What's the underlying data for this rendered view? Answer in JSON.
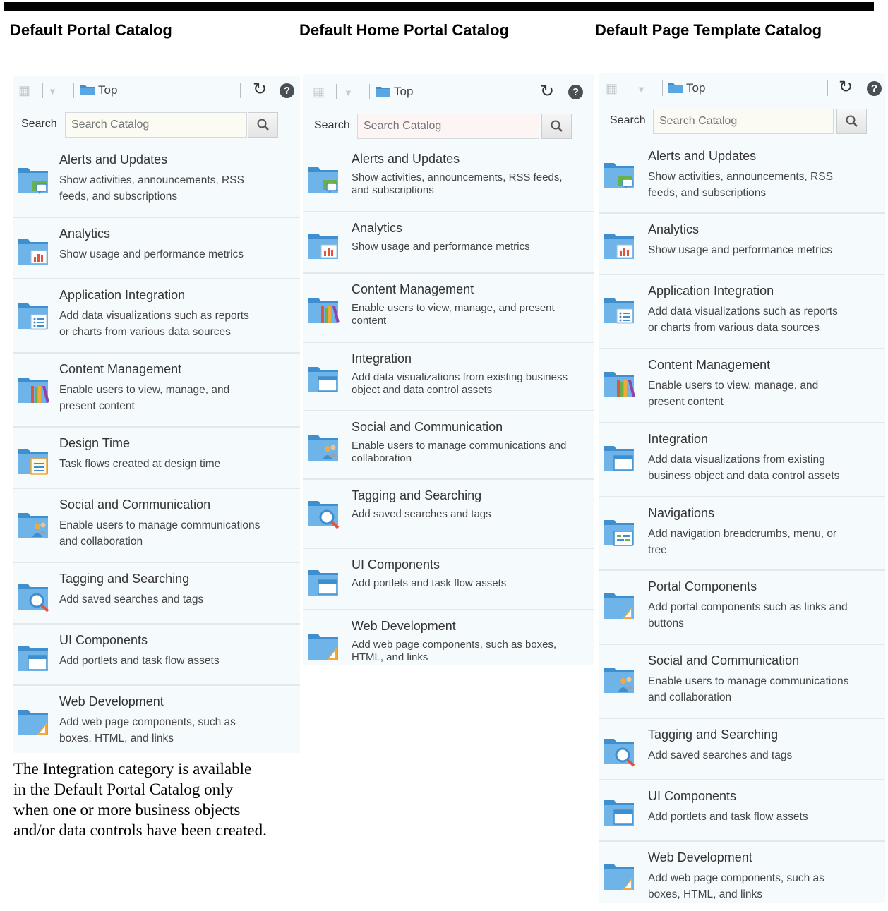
{
  "headers": [
    "Default Portal Catalog",
    "Default Home Portal Catalog",
    "Default Page Template Catalog"
  ],
  "toolbar": {
    "top_label": "Top",
    "search_label": "Search",
    "search_placeholder": "Search Catalog"
  },
  "catalogs": [
    {
      "items": [
        {
          "icon": "alerts-folder-icon",
          "title": "Alerts and Updates",
          "desc": [
            "Show activities, announcements, RSS",
            "feeds, and subscriptions"
          ]
        },
        {
          "icon": "analytics-folder-icon",
          "title": "Analytics",
          "desc": [
            "Show usage and performance metrics"
          ]
        },
        {
          "icon": "app-integration-folder-icon",
          "title": "Application Integration",
          "desc": [
            "Add data visualizations such as reports",
            "or charts from various data sources"
          ]
        },
        {
          "icon": "content-folder-icon",
          "title": "Content Management",
          "desc": [
            "Enable users to view, manage, and",
            "present content"
          ]
        },
        {
          "icon": "design-time-folder-icon",
          "title": "Design Time",
          "desc": [
            "Task flows created at design time"
          ]
        },
        {
          "icon": "social-folder-icon",
          "title": "Social and Communication",
          "desc": [
            "Enable users to manage communications",
            "and collaboration"
          ]
        },
        {
          "icon": "search-folder-icon",
          "title": "Tagging and Searching",
          "desc": [
            "Add saved searches and tags"
          ]
        },
        {
          "icon": "ui-folder-icon",
          "title": "UI Components",
          "desc": [
            "Add portlets and task flow assets"
          ]
        },
        {
          "icon": "webdev-folder-icon",
          "title": "Web Development",
          "desc": [
            "Add web page components, such as",
            "boxes, HTML, and links"
          ]
        }
      ]
    },
    {
      "items": [
        {
          "icon": "alerts-folder-icon",
          "title": "Alerts and Updates",
          "desc": [
            "Show activities, announcements, RSS feeds,",
            "and subscriptions"
          ]
        },
        {
          "icon": "analytics-folder-icon",
          "title": "Analytics",
          "desc": [
            "Show usage and performance metrics"
          ]
        },
        {
          "icon": "content-folder-icon",
          "title": "Content Management",
          "desc": [
            "Enable users to view, manage, and present",
            "content"
          ]
        },
        {
          "icon": "ui-folder-icon",
          "title": "Integration",
          "desc": [
            "Add data visualizations from existing business",
            "object and data control assets"
          ]
        },
        {
          "icon": "social-folder-icon",
          "title": "Social and Communication",
          "desc": [
            "Enable users to manage communications and",
            "collaboration"
          ]
        },
        {
          "icon": "search-folder-icon",
          "title": "Tagging and Searching",
          "desc": [
            "Add saved searches and tags"
          ]
        },
        {
          "icon": "ui-folder-icon",
          "title": "UI Components",
          "desc": [
            "Add portlets and task flow assets"
          ]
        },
        {
          "icon": "webdev-folder-icon",
          "title": "Web Development",
          "desc": [
            "Add web page components, such as boxes,",
            "HTML, and links"
          ]
        }
      ]
    },
    {
      "items": [
        {
          "icon": "alerts-folder-icon",
          "title": "Alerts and Updates",
          "desc": [
            "Show activities, announcements, RSS",
            "feeds, and subscriptions"
          ]
        },
        {
          "icon": "analytics-folder-icon",
          "title": "Analytics",
          "desc": [
            "Show usage and performance metrics"
          ]
        },
        {
          "icon": "app-integration-folder-icon",
          "title": "Application Integration",
          "desc": [
            "Add data visualizations such as reports",
            "or charts from various data sources"
          ]
        },
        {
          "icon": "content-folder-icon",
          "title": "Content Management",
          "desc": [
            "Enable users to view, manage, and",
            "present content"
          ]
        },
        {
          "icon": "ui-folder-icon",
          "title": "Integration",
          "desc": [
            "Add data visualizations from existing",
            "business object and data control assets"
          ]
        },
        {
          "icon": "navigation-folder-icon",
          "title": "Navigations",
          "desc": [
            "Add navigation breadcrumbs, menu, or",
            "tree"
          ]
        },
        {
          "icon": "webdev-folder-icon",
          "title": "Portal Components",
          "desc": [
            "Add portal components such as links and",
            "buttons"
          ]
        },
        {
          "icon": "social-folder-icon",
          "title": "Social and Communication",
          "desc": [
            "Enable users to manage communications",
            "and collaboration"
          ]
        },
        {
          "icon": "search-folder-icon",
          "title": "Tagging and Searching",
          "desc": [
            "Add saved searches and tags"
          ]
        },
        {
          "icon": "ui-folder-icon",
          "title": "UI Components",
          "desc": [
            "Add portlets and task flow assets"
          ]
        },
        {
          "icon": "webdev-folder-icon",
          "title": "Web Development",
          "desc": [
            "Add web page components, such as",
            "boxes, HTML, and links"
          ]
        }
      ]
    }
  ],
  "note": "The Integration category is available in the Default Portal Catalog only when one or more business objects and/or data controls have been created.",
  "colors": {
    "folder_back": "#3f8fcf",
    "folder_front": "#6fb4e8",
    "panel_bg": "#f5fbfd"
  }
}
